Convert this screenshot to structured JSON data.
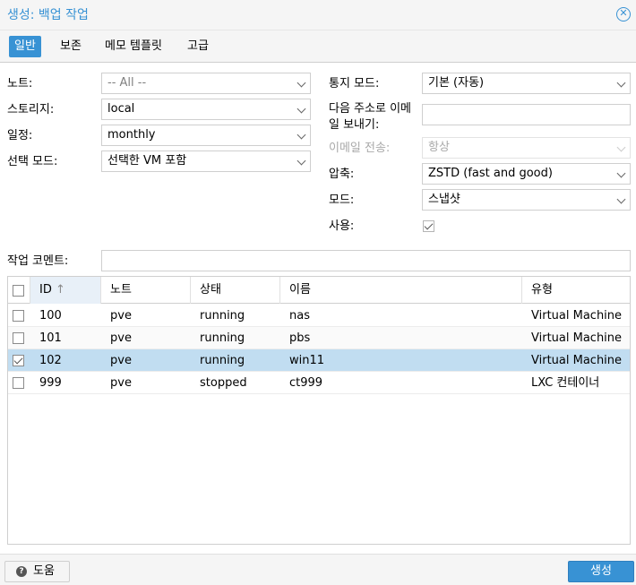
{
  "window": {
    "title": "생성: 백업 작업",
    "close_icon": "close-circle-icon"
  },
  "tabs": [
    {
      "label": "일반",
      "active": true
    },
    {
      "label": "보존",
      "active": false
    },
    {
      "label": "메모 템플릿",
      "active": false
    },
    {
      "label": "고급",
      "active": false
    }
  ],
  "form": {
    "node": {
      "label": "노트:",
      "value": "-- All --"
    },
    "storage": {
      "label": "스토리지:",
      "value": "local"
    },
    "schedule": {
      "label": "일정:",
      "value": "monthly"
    },
    "selection_mode": {
      "label": "선택 모드:",
      "value": "선택한 VM 포함"
    },
    "notify_mode": {
      "label": "통지 모드:",
      "value": "기본 (자동)"
    },
    "send_email_to": {
      "label_line1": "다음 주소로 이메",
      "label_line2": "일 보내기:",
      "value": ""
    },
    "email_send": {
      "label": "이메일 전송:",
      "value": "항상"
    },
    "compression": {
      "label": "압축:",
      "value": "ZSTD (fast and good)"
    },
    "mode": {
      "label": "모드:",
      "value": "스냅샷"
    },
    "enable": {
      "label": "사용:",
      "checked": true
    },
    "job_comment": {
      "label": "작업 코멘트:",
      "value": ""
    }
  },
  "grid": {
    "columns": [
      "ID",
      "노트",
      "상태",
      "이름",
      "유형"
    ],
    "sort_indicator": "↑",
    "rows": [
      {
        "id": "100",
        "node": "pve",
        "status": "running",
        "name": "nas",
        "type": "Virtual Machine",
        "checked": false
      },
      {
        "id": "101",
        "node": "pve",
        "status": "running",
        "name": "pbs",
        "type": "Virtual Machine",
        "checked": false
      },
      {
        "id": "102",
        "node": "pve",
        "status": "running",
        "name": "win11",
        "type": "Virtual Machine",
        "checked": true
      },
      {
        "id": "999",
        "node": "pve",
        "status": "stopped",
        "name": "ct999",
        "type": "LXC 컨테이너",
        "checked": false
      }
    ]
  },
  "footer": {
    "help_label": "도움",
    "help_icon": "question-circle-icon",
    "create_label": "생성"
  },
  "colors": {
    "accent": "#3892d4",
    "selected_row": "#c1ddf1"
  }
}
